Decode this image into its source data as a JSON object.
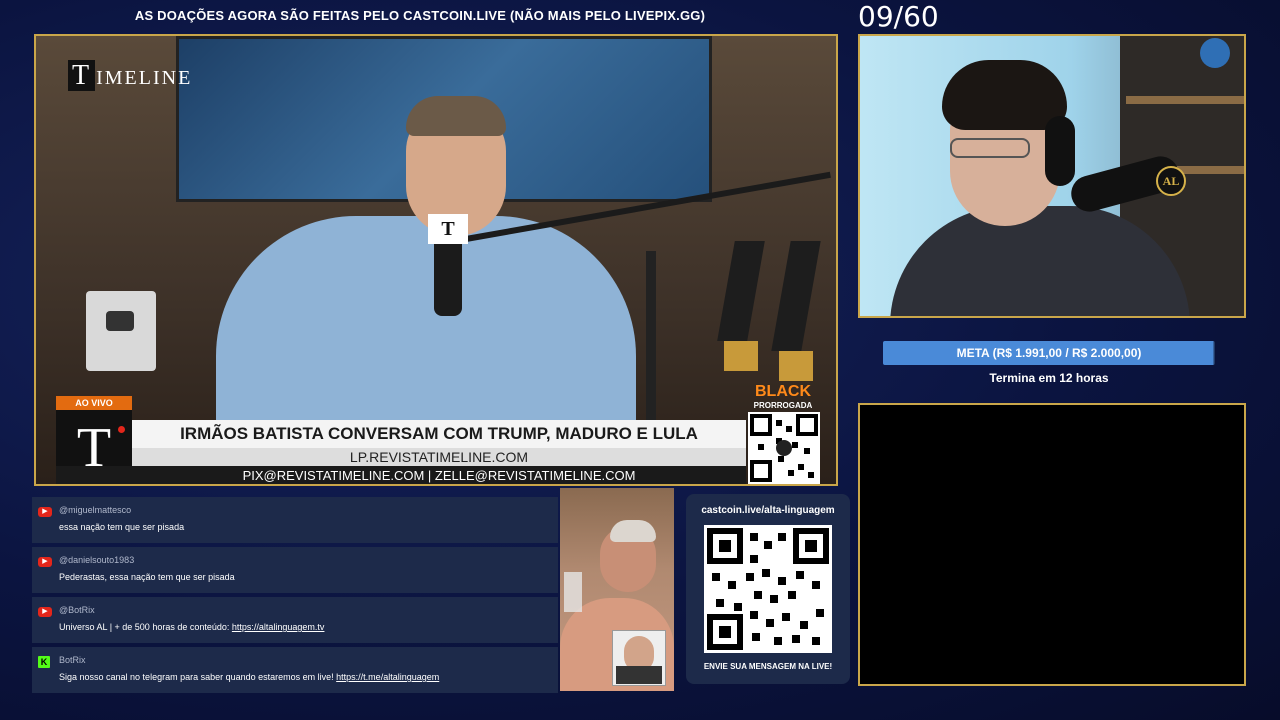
{
  "banner": "AS DOAÇÕES AGORA SÃO FEITAS PELO CASTCOIN.LIVE (NÃO MAIS PELO LIVEPIX.GG)",
  "counter": "09/60",
  "main_video": {
    "logo_initial": "T",
    "logo_rest": "IMELINE",
    "mic_flag": "T",
    "live_tag": "AO VIVO",
    "channel_letter": "T",
    "headline": "IRMÃOS BATISTA CONVERSAM COM TRUMP, MADURO E LULA",
    "site": "LP.REVISTATIMELINE.COM",
    "payment": "PIX@REVISTATIMELINE.COM | ZELLE@REVISTATIMELINE.COM",
    "promo_big": "BLACK",
    "promo_small": "PRORROGADA"
  },
  "webcam": {
    "badge": "AL"
  },
  "goal": {
    "label": "META (R$ 1.991,00 / R$ 2.000,00)",
    "ends": "Termina em 12 horas",
    "progress_fraction": 0.9955,
    "color": "#4a8ad8"
  },
  "chat": {
    "messages": [
      {
        "platform": "youtube",
        "user": "@miguelmattesco",
        "text": "essa nação tem que ser pisada",
        "link": ""
      },
      {
        "platform": "youtube",
        "user": "@danielsouto1983",
        "text": "Pederastas, essa nação tem que ser pisada",
        "link": ""
      },
      {
        "platform": "youtube",
        "user": "@BotRix",
        "text": "Universo AL | + de 500 horas de conteúdo: ",
        "link": "https://altalinguagem.tv"
      },
      {
        "platform": "kick",
        "user": "BotRix",
        "text": "Siga nosso canal no telegram para saber quando estaremos em live! ",
        "link": "https://t.me/altalinguagem"
      }
    ]
  },
  "donation": {
    "url": "castcoin.live/alta-linguagem",
    "cta": "ENVIE SUA MENSAGEM NA LIVE!"
  },
  "colors": {
    "frame_gold": "#c9a64a",
    "youtube_red": "#e3261b",
    "kick_green": "#53fc18",
    "promo_orange": "#ff8a1a"
  }
}
